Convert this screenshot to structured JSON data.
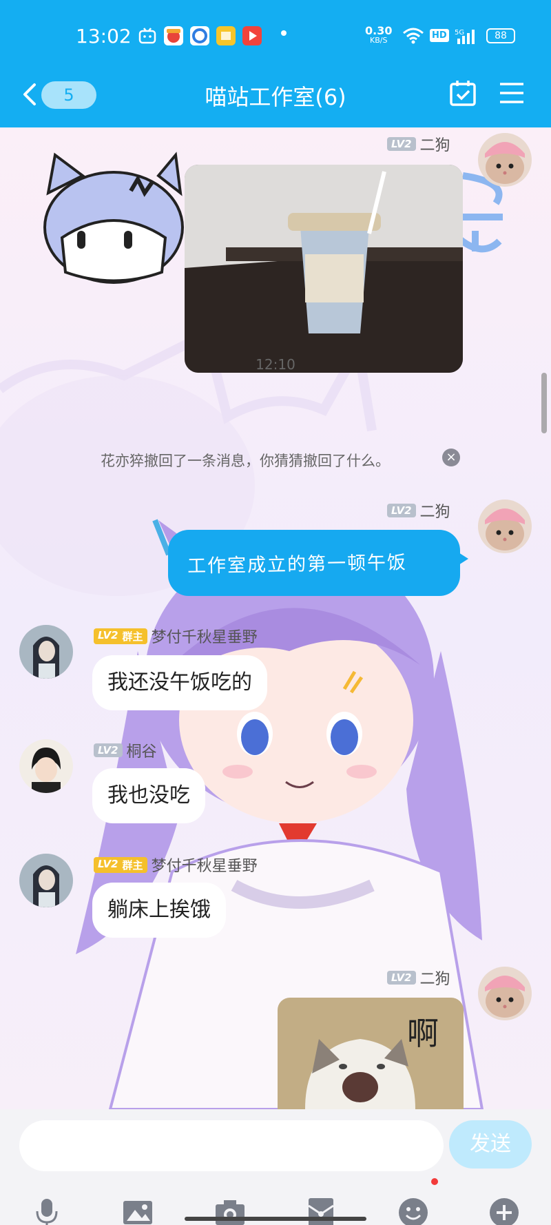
{
  "status_bar": {
    "time": "13:02",
    "net_speed": "0.30",
    "net_unit": "KB/S",
    "hd": "HD",
    "network": "5G",
    "battery": "88"
  },
  "header": {
    "back_badge": "5",
    "title": "喵站工作室(6)"
  },
  "chat": {
    "messages": [
      {
        "sender_level": "LV2",
        "sender": "二狗",
        "type": "image",
        "image_label": ""
      },
      {
        "time": "12:10"
      },
      {
        "recall_text": "花亦猝撤回了一条消息，你猜猜撤回了什么。"
      },
      {
        "sender_level": "LV2",
        "sender": "二狗",
        "type": "text",
        "text": "工作室成立的第一顿午饭"
      },
      {
        "sender_level": "LV2",
        "sender_role": "群主",
        "sender": "梦付千秋星垂野",
        "type": "text",
        "text": "我还没午饭吃的"
      },
      {
        "sender_level": "LV2",
        "sender": "桐谷",
        "type": "text",
        "text": "我也没吃"
      },
      {
        "sender_level": "LV2",
        "sender_role": "群主",
        "sender": "梦付千秋星垂野",
        "type": "text",
        "text": "躺床上挨饿"
      },
      {
        "sender_level": "LV2",
        "sender": "二狗",
        "type": "image",
        "image_label": "啊"
      }
    ]
  },
  "input": {
    "placeholder": "",
    "send_label": "发送"
  },
  "toolbar": {
    "icons": [
      "microphone-icon",
      "image-icon",
      "camera-icon",
      "red-packet-icon",
      "emoji-icon",
      "plus-icon"
    ]
  },
  "colors": {
    "header_bg": "#14aef2",
    "bubble_blue": "#16a9f0",
    "owner_badge": "#f5c02c",
    "lv_badge": "#b8c0cc"
  }
}
